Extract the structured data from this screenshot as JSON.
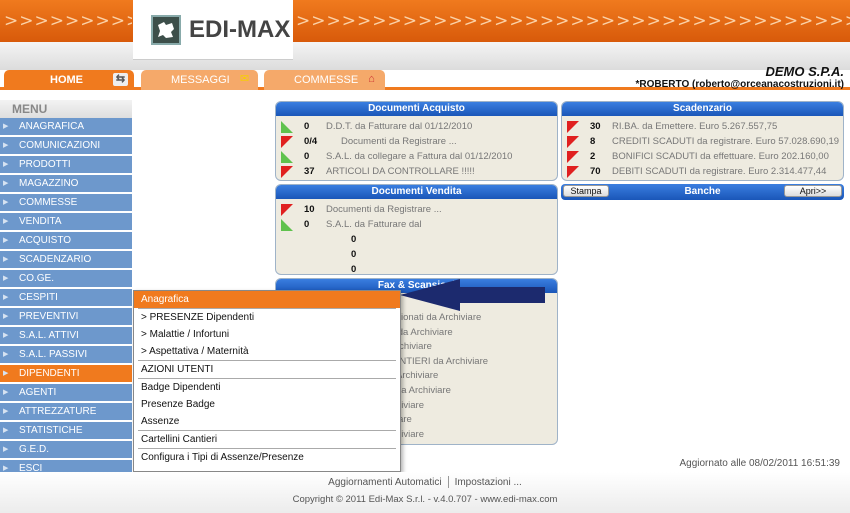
{
  "header": {
    "logo_text": "EDI-MAX",
    "company_name": "DEMO S.P.A.",
    "user": "*ROBERTO (roberto@orceanacostruzioni.it)"
  },
  "tabs": [
    {
      "label": "HOME",
      "icon": "home-switch-icon"
    },
    {
      "label": "MESSAGGI",
      "icon": "envelope-icon"
    },
    {
      "label": "COMMESSE",
      "icon": "house-icon"
    }
  ],
  "menu": {
    "title": "MENU",
    "items": [
      "ANAGRAFICA",
      "COMUNICAZIONI",
      "PRODOTTI",
      "MAGAZZINO",
      "COMMESSE",
      "VENDITA",
      "ACQUISTO",
      "SCADENZARIO",
      "CO.GE.",
      "CESPITI",
      "PREVENTIVI",
      "S.A.L. ATTIVI",
      "S.A.L. PASSIVI",
      "DIPENDENTI",
      "AGENTI",
      "ATTREZZATURE",
      "STATISTICHE",
      "G.E.D.",
      "ESCI"
    ],
    "active_index": 13
  },
  "documenti_acquisto": {
    "title": "Documenti Acquisto",
    "rows": [
      {
        "flag": "green",
        "num": "0",
        "text": "D.D.T. da Fatturare dal 01/12/2010"
      },
      {
        "flag": "red",
        "num": "0/4",
        "text": "Documenti da Registrare ..."
      },
      {
        "flag": "green",
        "num": "0",
        "text": "S.A.L. da collegare a Fattura dal 01/12/2010"
      },
      {
        "flag": "red",
        "num": "37",
        "text": "ARTICOLI DA CONTROLLARE !!!!!"
      }
    ]
  },
  "scadenzario": {
    "title": "Scadenzario",
    "rows": [
      {
        "flag": "red",
        "num": "30",
        "text": "RI.BA. da Emettere. Euro 5.267.557,75"
      },
      {
        "flag": "red",
        "num": "8",
        "text": "CREDITI SCADUTI da registrare. Euro 57.028.690,19"
      },
      {
        "flag": "red",
        "num": "2",
        "text": "BONIFICI SCADUTI da effettuare. Euro 202.160,00"
      },
      {
        "flag": "red",
        "num": "70",
        "text": "DEBITI SCADUTI da registrare. Euro 2.314.477,44"
      }
    ]
  },
  "banche": {
    "title": "Banche",
    "stampa_label": "Stampa",
    "apri_label": "Apri>>"
  },
  "documenti_vendita": {
    "title": "Documenti Vendita",
    "rows": [
      {
        "flag": "red",
        "num": "10",
        "text": "Documenti da Registrare ..."
      },
      {
        "flag": "green",
        "num": "0",
        "text": "S.A.L. da Fatturare dal"
      }
    ],
    "extra_nums": [
      "0",
      "0",
      "0"
    ]
  },
  "fax": {
    "title": "Fax & Scansioni",
    "partial_rows": [
      "ionati da Archiviare",
      "i da Archiviare",
      "rchiviare",
      "ANTIERI da Archiviare",
      "Archiviare",
      "da Archiviare",
      "hiviare",
      "iare",
      "hiviare"
    ]
  },
  "dropdown": {
    "items": [
      {
        "label": "Anagrafica",
        "hl": true
      },
      {
        "label": "> PRESENZE Dipendenti"
      },
      {
        "label": "> Malattie / Infortuni"
      },
      {
        "label": "> Aspettativa / Maternità"
      },
      {
        "label": "AZIONI UTENTI"
      },
      {
        "label": "Badge Dipendenti"
      },
      {
        "label": "Presenze Badge"
      },
      {
        "label": "Assenze"
      },
      {
        "label": "Cartellini Cantieri"
      },
      {
        "label": "Configura i Tipi di Assenze/Presenze"
      }
    ]
  },
  "footer": {
    "updated": "Aggiornato alle 08/02/2011 16:51:39",
    "link1": "Aggiornamenti Automatici",
    "link2": "Impostazioni ...",
    "copyright": "Copyright © 2011 Edi-Max S.r.l. - v.4.0.707 - www.edi-max.com"
  },
  "colors": {
    "orange": "#f07a1e",
    "menu_blue": "#6d98cc",
    "panel_head_blue": "#1a56b8",
    "arrow_navy": "#1c2a6e"
  }
}
